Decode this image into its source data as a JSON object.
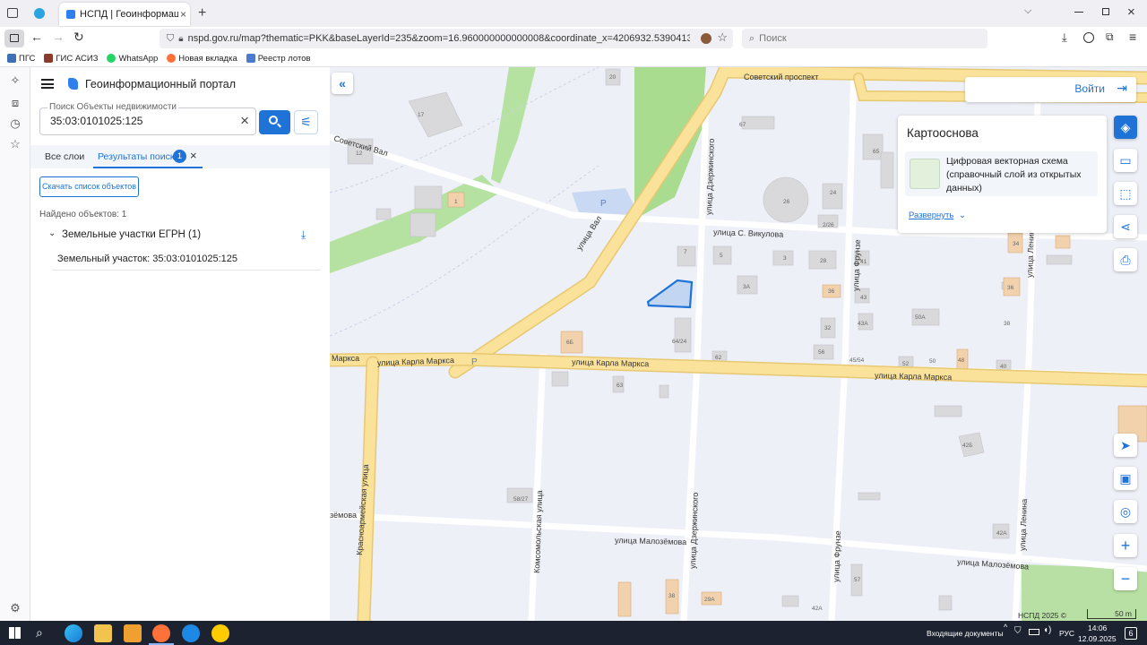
{
  "browser": {
    "tab_title": "НСПД | Геоинформационны",
    "url": "nspd.gov.ru/map?thematic=PKK&baseLayerId=235&zoom=16.960000000000008&coordinate_x=4206932.539041332&coordinate_y=840",
    "search_placeholder": "Поиск",
    "bookmarks": [
      "ПГС",
      "ГИС АСИЗ",
      "WhatsApp",
      "Новая вкладка",
      "Реестр лотов"
    ]
  },
  "app": {
    "title": "Геоинформационный портал",
    "search": {
      "label": "Поиск Объекты недвижимости",
      "value": "35:03:0101025:125"
    },
    "tabs": [
      {
        "label": "Все слои"
      },
      {
        "label": "Результаты поиска",
        "badge": "1"
      }
    ],
    "download_button": "Скачать список объектов",
    "found_count": "Найдено объектов: 1",
    "group_label": "Земельные участки ЕГРН (1)",
    "result_item": "Земельный участок: 35:03:0101025:125"
  },
  "map": {
    "login": "Войти",
    "basemap_title": "Картооснова",
    "basemap_item": "Цифровая векторная схема (справочный слой из открытых данных)",
    "expand_link": "Развернуть",
    "copyright": "НСПД 2025 ©",
    "scale": "50 m",
    "streets": {
      "sovetsky_prospekt": "Советский проспект",
      "sovetsky_val": "Советский Вал",
      "vikulova": "улица С. Викулова",
      "val": "улица Вал",
      "karla_marksa_1": "улица Карла Маркса",
      "karla_marksa_2": "улица Карла Маркса",
      "karla_marksa_3": "улица Карла Маркса",
      "karla_marksa_cut": "Маркса",
      "dzerzhinskogo_1": "улица Дзержинского",
      "dzerzhinskogo_2": "улица Дзержинского",
      "frunze_1": "улица Фрунзе",
      "frunze_2": "улица Фрунзе",
      "lenina_1": "улица Ленина",
      "lenina_2": "улица Ленина",
      "krasnoarmeyskaya": "Красноармейская улица",
      "komsomolskaya": "Комсомольская улица",
      "malozemova_1": "улица Малозёмова",
      "malozemova_2": "улица Малозёмова",
      "malozemova_cut": "зёмова"
    },
    "house_numbers": [
      "20",
      "17",
      "12",
      "1",
      "67",
      "65",
      "26",
      "24",
      "2/26",
      "7",
      "5",
      "3",
      "28",
      "41",
      "34",
      "36",
      "3А",
      "36",
      "43",
      "43А",
      "50А",
      "38",
      "6Б",
      "64/24",
      "32",
      "56",
      "62",
      "45/54",
      "52",
      "50",
      "48",
      "40",
      "63",
      "42Б",
      "58/27",
      "42А",
      "57",
      "38",
      "29А",
      "42А"
    ],
    "parking": [
      "P",
      "P"
    ]
  },
  "taskbar": {
    "notification": "Входящие документы",
    "lang": "РУС",
    "time": "14:06",
    "date": "12.09.2025",
    "badge": "6"
  }
}
